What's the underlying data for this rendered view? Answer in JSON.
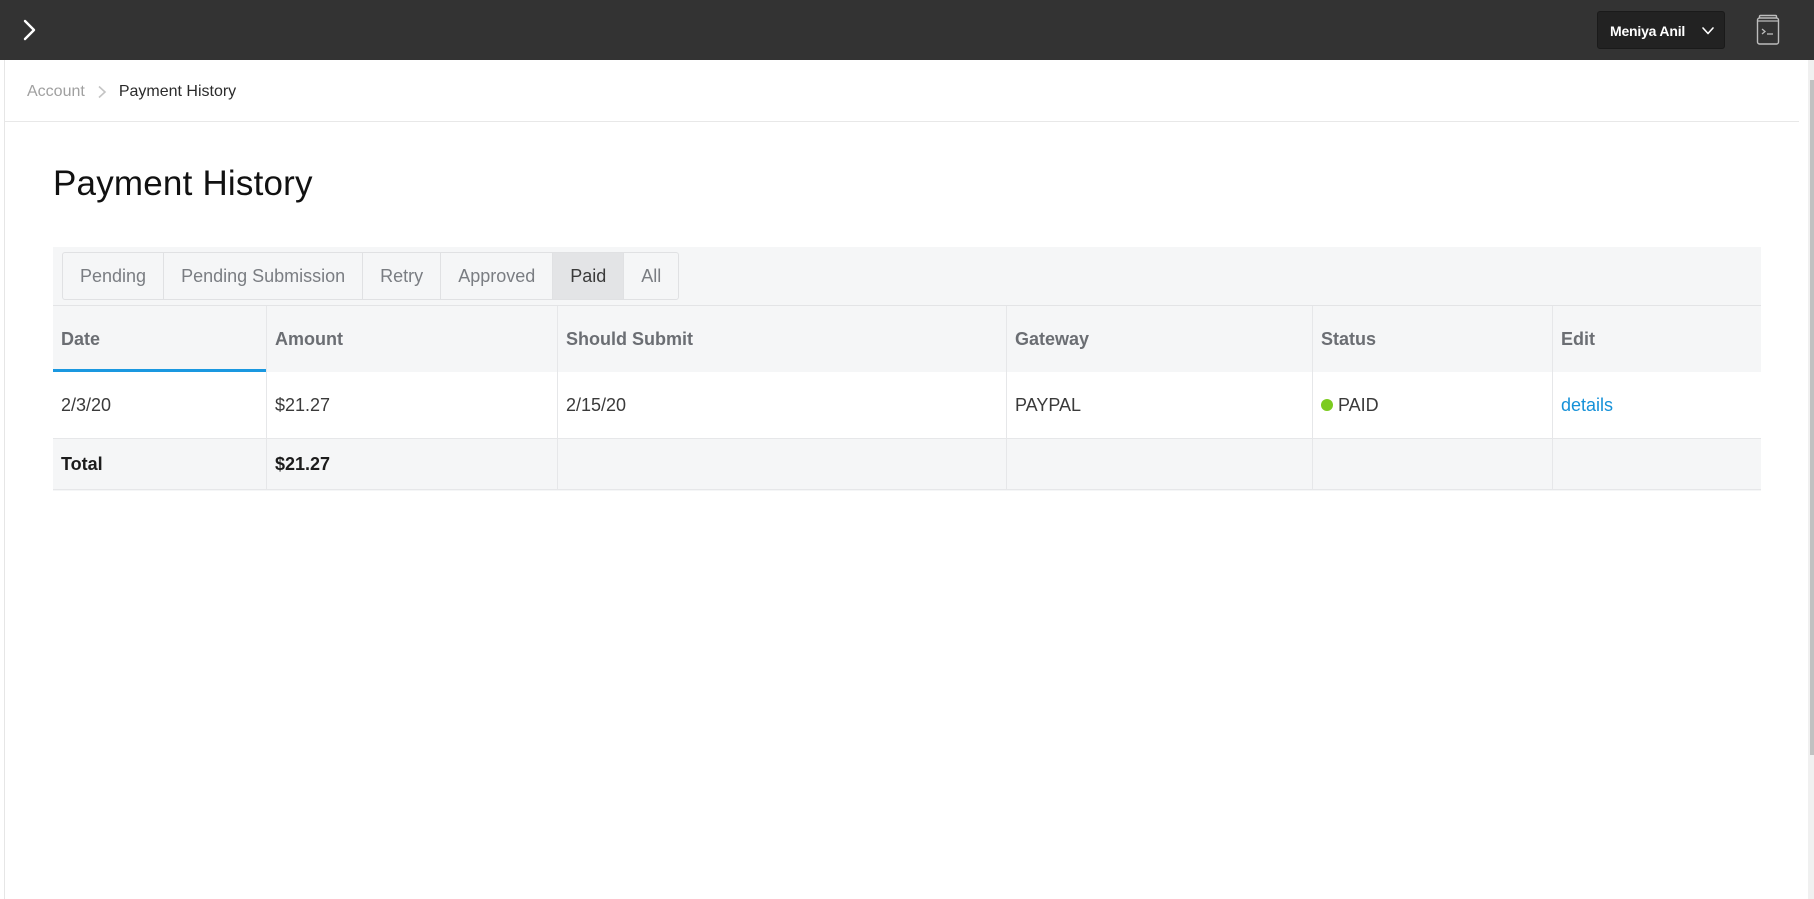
{
  "topbar": {
    "expand_icon": "chevron-right-icon",
    "user_name": "Meniya Anil",
    "user_menu_icon": "chevron-down-icon",
    "console_icon": "terminal-book-icon"
  },
  "breadcrumb": {
    "items": [
      {
        "label": "Account"
      },
      {
        "label": "Payment History"
      }
    ],
    "separator_icon": "chevron-right-icon"
  },
  "page": {
    "title": "Payment History"
  },
  "filters": {
    "tabs": [
      {
        "label": "Pending",
        "active": false
      },
      {
        "label": "Pending Submission",
        "active": false
      },
      {
        "label": "Retry",
        "active": false
      },
      {
        "label": "Approved",
        "active": false
      },
      {
        "label": "Paid",
        "active": true
      },
      {
        "label": "All",
        "active": false
      }
    ]
  },
  "table": {
    "columns": [
      "Date",
      "Amount",
      "Should Submit",
      "Gateway",
      "Status",
      "Edit"
    ],
    "sorted_column": "Date",
    "rows": [
      {
        "date": "2/3/20",
        "amount": "$21.27",
        "should_submit": "2/15/20",
        "gateway": "PAYPAL",
        "status": "PAID",
        "status_color": "#7ccb1f",
        "edit_link": "details"
      }
    ],
    "total": {
      "label": "Total",
      "amount": "$21.27"
    }
  },
  "colors": {
    "accent": "#1a98e0",
    "link": "#1591d8",
    "topbar": "#333333",
    "paid_status": "#7ccb1f"
  }
}
